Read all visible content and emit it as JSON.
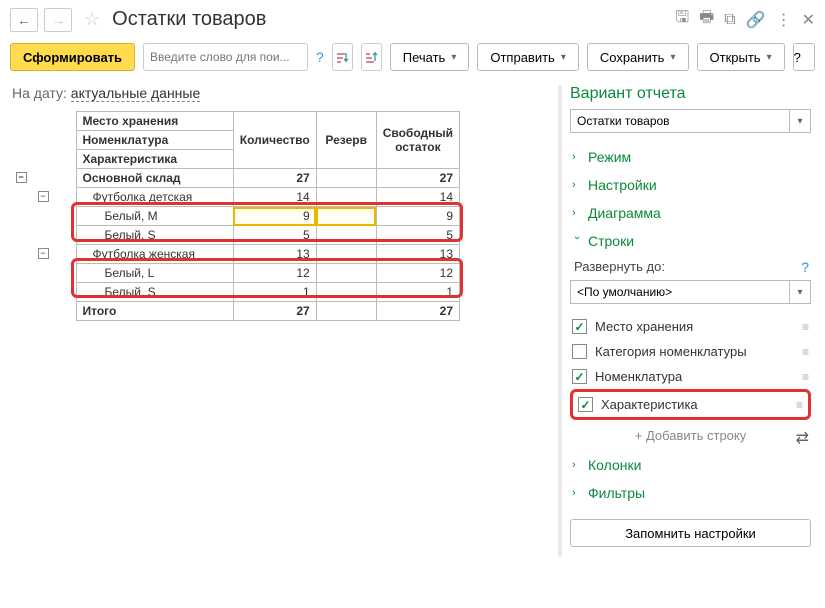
{
  "header": {
    "title": "Остатки товаров"
  },
  "toolbar": {
    "generate": "Сформировать",
    "search_placeholder": "Введите слово для пои...",
    "print": "Печать",
    "send": "Отправить",
    "save": "Сохранить",
    "open": "Открыть"
  },
  "date_filter": {
    "label": "На дату:",
    "value": "актуальные данные"
  },
  "table": {
    "headers": {
      "storage": "Место хранения",
      "nomenclature": "Номенклатура",
      "characteristic": "Характеристика",
      "qty": "Количество",
      "reserve": "Резерв",
      "free": "Свободный остаток"
    },
    "rows": [
      {
        "level": 0,
        "name": "Основной склад",
        "qty": "27",
        "free": "27",
        "bold": true,
        "expander": "-"
      },
      {
        "level": 1,
        "name": "Футболка детская",
        "qty": "14",
        "free": "14",
        "expander": "-"
      },
      {
        "level": 2,
        "name": "Белый, M",
        "qty": "9",
        "free": "9",
        "highlight": true
      },
      {
        "level": 2,
        "name": "Белый, S",
        "qty": "5",
        "free": "5"
      },
      {
        "level": 1,
        "name": "Футболка женская",
        "qty": "13",
        "free": "13",
        "expander": "-"
      },
      {
        "level": 2,
        "name": "Белый, L",
        "qty": "12",
        "free": "12"
      },
      {
        "level": 2,
        "name": "Белый, S",
        "qty": "1",
        "free": "1"
      }
    ],
    "total": {
      "label": "Итого",
      "qty": "27",
      "free": "27"
    }
  },
  "sidebar": {
    "variant_title": "Вариант отчета",
    "variant_value": "Остатки товаров",
    "sections": {
      "mode": "Режим",
      "settings": "Настройки",
      "diagram": "Диаграмма",
      "rows": "Строки",
      "columns": "Колонки",
      "filters": "Фильтры"
    },
    "rows_panel": {
      "expand_label": "Развернуть до:",
      "expand_value": "<По умолчанию>",
      "items": [
        {
          "label": "Место хранения",
          "checked": true
        },
        {
          "label": "Категория номенклатуры",
          "checked": false
        },
        {
          "label": "Номенклатура",
          "checked": true
        },
        {
          "label": "Характеристика",
          "checked": true
        }
      ],
      "add": "+ Добавить строку"
    },
    "remember": "Запомнить настройки"
  }
}
